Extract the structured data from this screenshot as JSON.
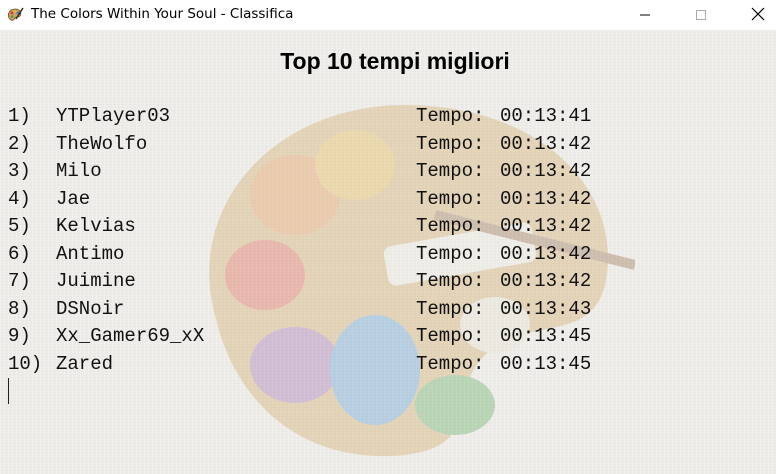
{
  "window": {
    "title": "The Colors Within Your Soul - Classifica",
    "icons": {
      "app": "palette-icon",
      "minimize": "minimize-icon",
      "maximize": "maximize-icon",
      "close": "close-icon"
    }
  },
  "heading": "Top 10 tempi migliori",
  "time_label": "Tempo:",
  "leaderboard": [
    {
      "rank": "1)",
      "name": "YTPlayer03",
      "time": "00:13:41"
    },
    {
      "rank": "2)",
      "name": "TheWolfo",
      "time": "00:13:42"
    },
    {
      "rank": "3)",
      "name": "Milo",
      "time": "00:13:42"
    },
    {
      "rank": "4)",
      "name": "Jae",
      "time": "00:13:42"
    },
    {
      "rank": "5)",
      "name": "Kelvias",
      "time": "00:13:42"
    },
    {
      "rank": "6)",
      "name": "Antimo",
      "time": "00:13:42"
    },
    {
      "rank": "7)",
      "name": "Juimine",
      "time": "00:13:42"
    },
    {
      "rank": "8)",
      "name": "DSNoir",
      "time": "00:13:43"
    },
    {
      "rank": "9)",
      "name": "Xx_Gamer69_xX",
      "time": "00:13:45"
    },
    {
      "rank": "10)",
      "name": "Zared",
      "time": "00:13:45"
    }
  ],
  "background_image": "paint-palette-watermark"
}
